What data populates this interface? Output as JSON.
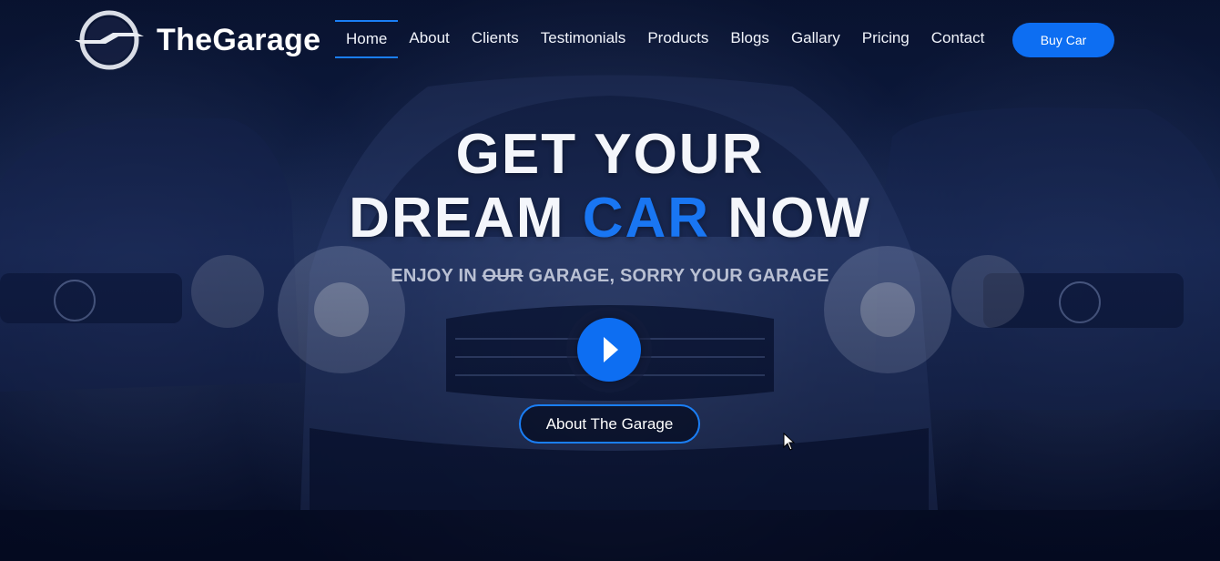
{
  "brand": {
    "name": "TheGarage",
    "logo_icon": "lightning-emblem-icon"
  },
  "nav": {
    "items": [
      {
        "label": "Home",
        "active": true
      },
      {
        "label": "About"
      },
      {
        "label": "Clients"
      },
      {
        "label": "Testimonials"
      },
      {
        "label": "Products"
      },
      {
        "label": "Blogs"
      },
      {
        "label": "Gallary"
      },
      {
        "label": "Pricing"
      },
      {
        "label": "Contact"
      }
    ],
    "cta_label": "Buy Car"
  },
  "hero": {
    "line1": "GET YOUR",
    "line2_prefix": "DREAM ",
    "line2_accent": "CAR",
    "line2_suffix": " NOW",
    "tagline_prefix": "ENJOY IN ",
    "tagline_struck": "OUR",
    "tagline_suffix": " GARAGE, SORRY YOUR GARAGE",
    "play_icon": "play-icon",
    "about_button_label": "About The Garage"
  },
  "colors": {
    "accent": "#0d6ef2",
    "text": "#ffffff",
    "subtext": "#b9c0d3"
  }
}
